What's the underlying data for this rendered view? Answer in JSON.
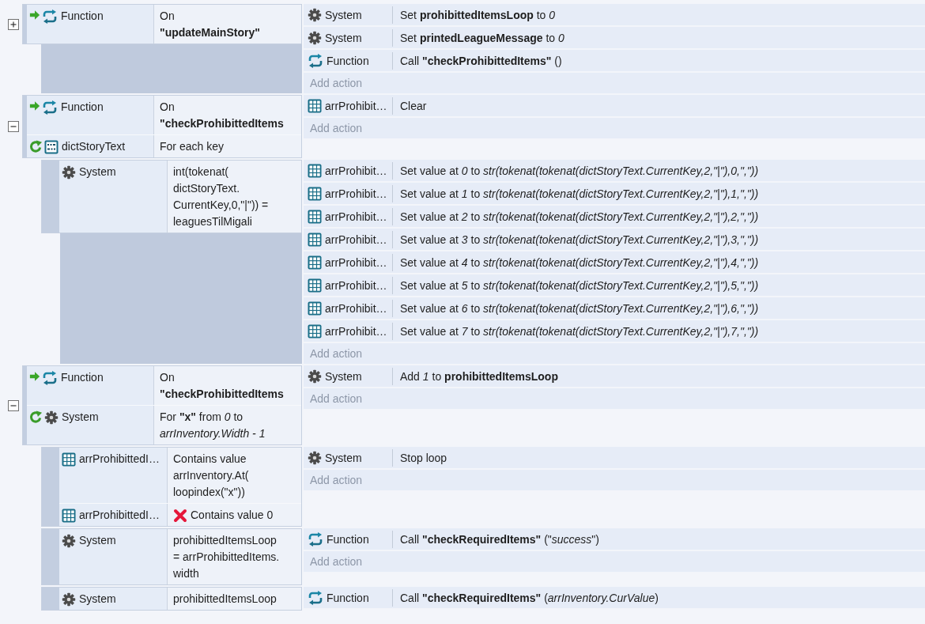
{
  "events": [
    {
      "expanded": false,
      "conditions": [
        {
          "kind": "function",
          "object": "Function",
          "trigger": true,
          "lines": [
            "On",
            "**\"updateMainStory\"**"
          ]
        }
      ],
      "actions": [
        {
          "kind": "system",
          "object": "System",
          "text": "Set **prohibittedItemsLoop** to *0*"
        },
        {
          "kind": "system",
          "object": "System",
          "text": "Set **printedLeagueMessage** to *0*"
        },
        {
          "kind": "function",
          "object": "Function",
          "text": "Call **\"checkProhibittedItems\"** ()"
        }
      ],
      "add_action": "Add action"
    },
    {
      "expanded": true,
      "conditions": [
        {
          "kind": "function",
          "object": "Function",
          "trigger": true,
          "lines": [
            "On",
            "**\"checkProhibittedItems**"
          ]
        },
        {
          "kind": "dictionary",
          "object": "dictStoryText",
          "loop": true,
          "lines": [
            "For each key"
          ]
        }
      ],
      "actions": [
        {
          "kind": "array",
          "object": "arrProhibit…",
          "text": "Clear"
        }
      ],
      "add_action": "Add action",
      "children": [
        {
          "conditions": [
            {
              "kind": "system",
              "object": "System",
              "lines": [
                "int(tokenat(",
                "dictStoryText.",
                "CurrentKey,0,\"|\")) =",
                "leaguesTilMigali"
              ]
            }
          ],
          "actions": [
            {
              "kind": "array",
              "object": "arrProhibit…",
              "text": "Set value at *0* to *str(tokenat(tokenat(dictStoryText.CurrentKey,2,\"|\"),0,\",\"))*"
            },
            {
              "kind": "array",
              "object": "arrProhibit…",
              "text": "Set value at *1* to *str(tokenat(tokenat(dictStoryText.CurrentKey,2,\"|\"),1,\",\"))*"
            },
            {
              "kind": "array",
              "object": "arrProhibit…",
              "text": "Set value at *2* to *str(tokenat(tokenat(dictStoryText.CurrentKey,2,\"|\"),2,\",\"))*"
            },
            {
              "kind": "array",
              "object": "arrProhibit…",
              "text": "Set value at *3* to *str(tokenat(tokenat(dictStoryText.CurrentKey,2,\"|\"),3,\",\"))*"
            },
            {
              "kind": "array",
              "object": "arrProhibit…",
              "text": "Set value at *4* to *str(tokenat(tokenat(dictStoryText.CurrentKey,2,\"|\"),4,\",\"))*"
            },
            {
              "kind": "array",
              "object": "arrProhibit…",
              "text": "Set value at *5* to *str(tokenat(tokenat(dictStoryText.CurrentKey,2,\"|\"),5,\",\"))*"
            },
            {
              "kind": "array",
              "object": "arrProhibit…",
              "text": "Set value at *6* to *str(tokenat(tokenat(dictStoryText.CurrentKey,2,\"|\"),6,\",\"))*"
            },
            {
              "kind": "array",
              "object": "arrProhibit…",
              "text": "Set value at *7* to *str(tokenat(tokenat(dictStoryText.CurrentKey,2,\"|\"),7,\",\"))*"
            }
          ],
          "add_action": "Add action"
        }
      ]
    },
    {
      "expanded": true,
      "conditions": [
        {
          "kind": "function",
          "object": "Function",
          "trigger": true,
          "lines": [
            "On",
            "**\"checkProhibittedItems**"
          ]
        },
        {
          "kind": "system",
          "object": "System",
          "loop": true,
          "lines": [
            "For **\"x\"** from *0* to",
            "*arrInventory.Width - 1*"
          ]
        }
      ],
      "actions": [
        {
          "kind": "system",
          "object": "System",
          "text": "Add *1* to **prohibittedItemsLoop**"
        }
      ],
      "add_action": "Add action",
      "children": [
        {
          "conditions": [
            {
              "kind": "array",
              "object": "arrProhibittedI…",
              "lines": [
                "Contains value",
                "arrInventory.At(",
                "loopindex(\"x\"))"
              ]
            },
            {
              "kind": "array",
              "object": "arrProhibittedI…",
              "inverted": true,
              "lines": [
                "Contains value 0"
              ]
            }
          ],
          "actions": [
            {
              "kind": "system",
              "object": "System",
              "text": "Stop loop"
            }
          ],
          "add_action": "Add action"
        },
        {
          "conditions": [
            {
              "kind": "system",
              "object": "System",
              "lines": [
                "prohibittedItemsLoop",
                "= arrProhibittedItems.",
                "width"
              ]
            }
          ],
          "actions": [
            {
              "kind": "function",
              "object": "Function",
              "text": "Call **\"checkRequiredItems\"** (\"*success*\")"
            }
          ],
          "add_action": "Add action"
        },
        {
          "conditions": [
            {
              "kind": "system",
              "object": "System",
              "lines": [
                "prohibittedItemsLoop"
              ]
            }
          ],
          "actions": [
            {
              "kind": "function",
              "object": "Function",
              "text": "Call **\"checkRequiredItems\"** (*arrInventory.CurValue*)"
            }
          ]
        }
      ]
    }
  ]
}
